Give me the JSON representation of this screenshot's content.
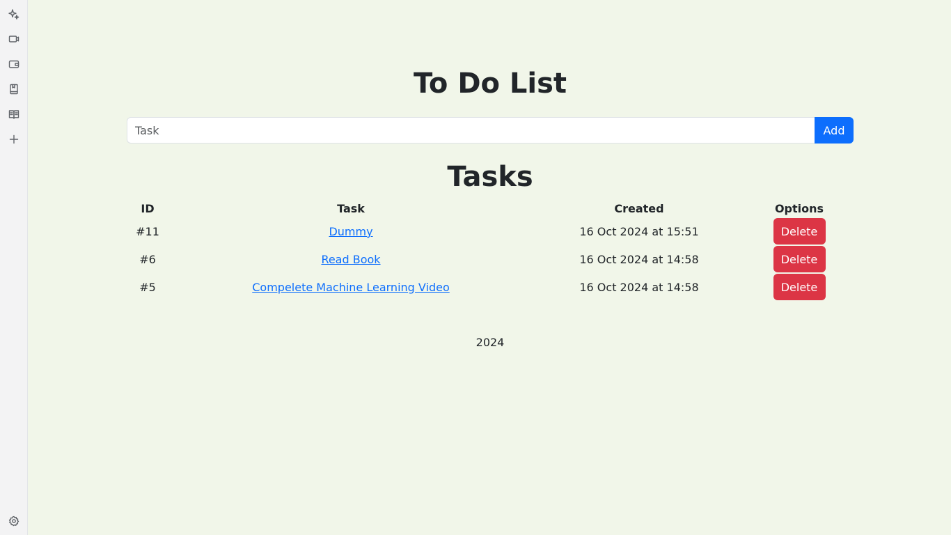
{
  "sidebar": {
    "icons": [
      {
        "name": "sparkle-icon"
      },
      {
        "name": "video-icon"
      },
      {
        "name": "wallet-icon"
      },
      {
        "name": "bookmark-icon"
      },
      {
        "name": "book-open-icon"
      },
      {
        "name": "plus-icon"
      },
      {
        "name": "settings-icon"
      }
    ]
  },
  "page": {
    "title": "To Do List",
    "tasks_heading": "Tasks",
    "footer": "2024"
  },
  "form": {
    "placeholder": "Task",
    "add_label": "Add"
  },
  "table": {
    "headers": [
      "ID",
      "Task",
      "Created",
      "Options"
    ],
    "rows": [
      {
        "id": "#11",
        "task": "Dummy",
        "created": "16 Oct 2024 at 15:51",
        "action": "Delete"
      },
      {
        "id": "#6",
        "task": "Read Book",
        "created": "16 Oct 2024 at 14:58",
        "action": "Delete"
      },
      {
        "id": "#5",
        "task": "Compelete Machine Learning Video",
        "created": "16 Oct 2024 at 14:58",
        "action": "Delete"
      }
    ]
  },
  "colors": {
    "background": "#f1f6e9",
    "primary": "#0d6efd",
    "danger": "#dc3545"
  }
}
